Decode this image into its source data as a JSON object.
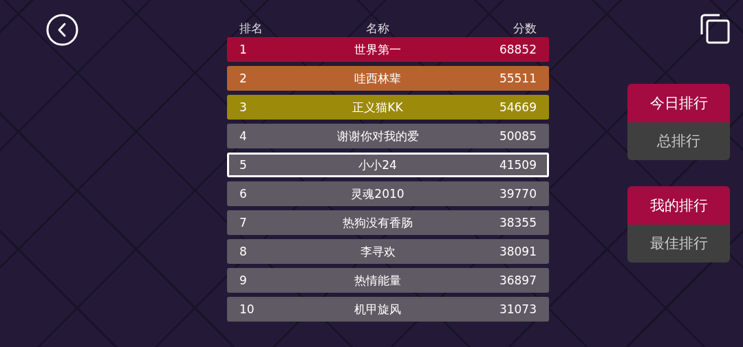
{
  "columns": [
    "排名",
    "名称",
    "分数"
  ],
  "rows": [
    {
      "rank": "1",
      "name": "世界第一",
      "score": "68852",
      "color": "#a50a36",
      "selected": false
    },
    {
      "rank": "2",
      "name": "哇西林辈",
      "score": "55511",
      "color": "#b8622f",
      "selected": false
    },
    {
      "rank": "3",
      "name": "正义猫KK",
      "score": "54669",
      "color": "#9c8a0a",
      "selected": false
    },
    {
      "rank": "4",
      "name": "谢谢你对我的爱",
      "score": "50085",
      "color": "#5f5a63",
      "selected": false
    },
    {
      "rank": "5",
      "name": "小小24",
      "score": "41509",
      "color": "#5f5a63",
      "selected": true
    },
    {
      "rank": "6",
      "name": "灵魂2010",
      "score": "39770",
      "color": "#5f5a63",
      "selected": false
    },
    {
      "rank": "7",
      "name": "热狗没有香肠",
      "score": "38355",
      "color": "#5f5a63",
      "selected": false
    },
    {
      "rank": "8",
      "name": "李寻欢",
      "score": "38091",
      "color": "#5f5a63",
      "selected": false
    },
    {
      "rank": "9",
      "name": "热情能量",
      "score": "36897",
      "color": "#5f5a63",
      "selected": false
    },
    {
      "rank": "10",
      "name": "机甲旋风",
      "score": "31073",
      "color": "#5f5a63",
      "selected": false
    }
  ],
  "period_toggle": [
    {
      "label": "今日排行",
      "selected": true
    },
    {
      "label": "总排行",
      "selected": false
    }
  ],
  "scope_toggle": [
    {
      "label": "我的排行",
      "selected": true
    },
    {
      "label": "最佳排行",
      "selected": false
    }
  ]
}
